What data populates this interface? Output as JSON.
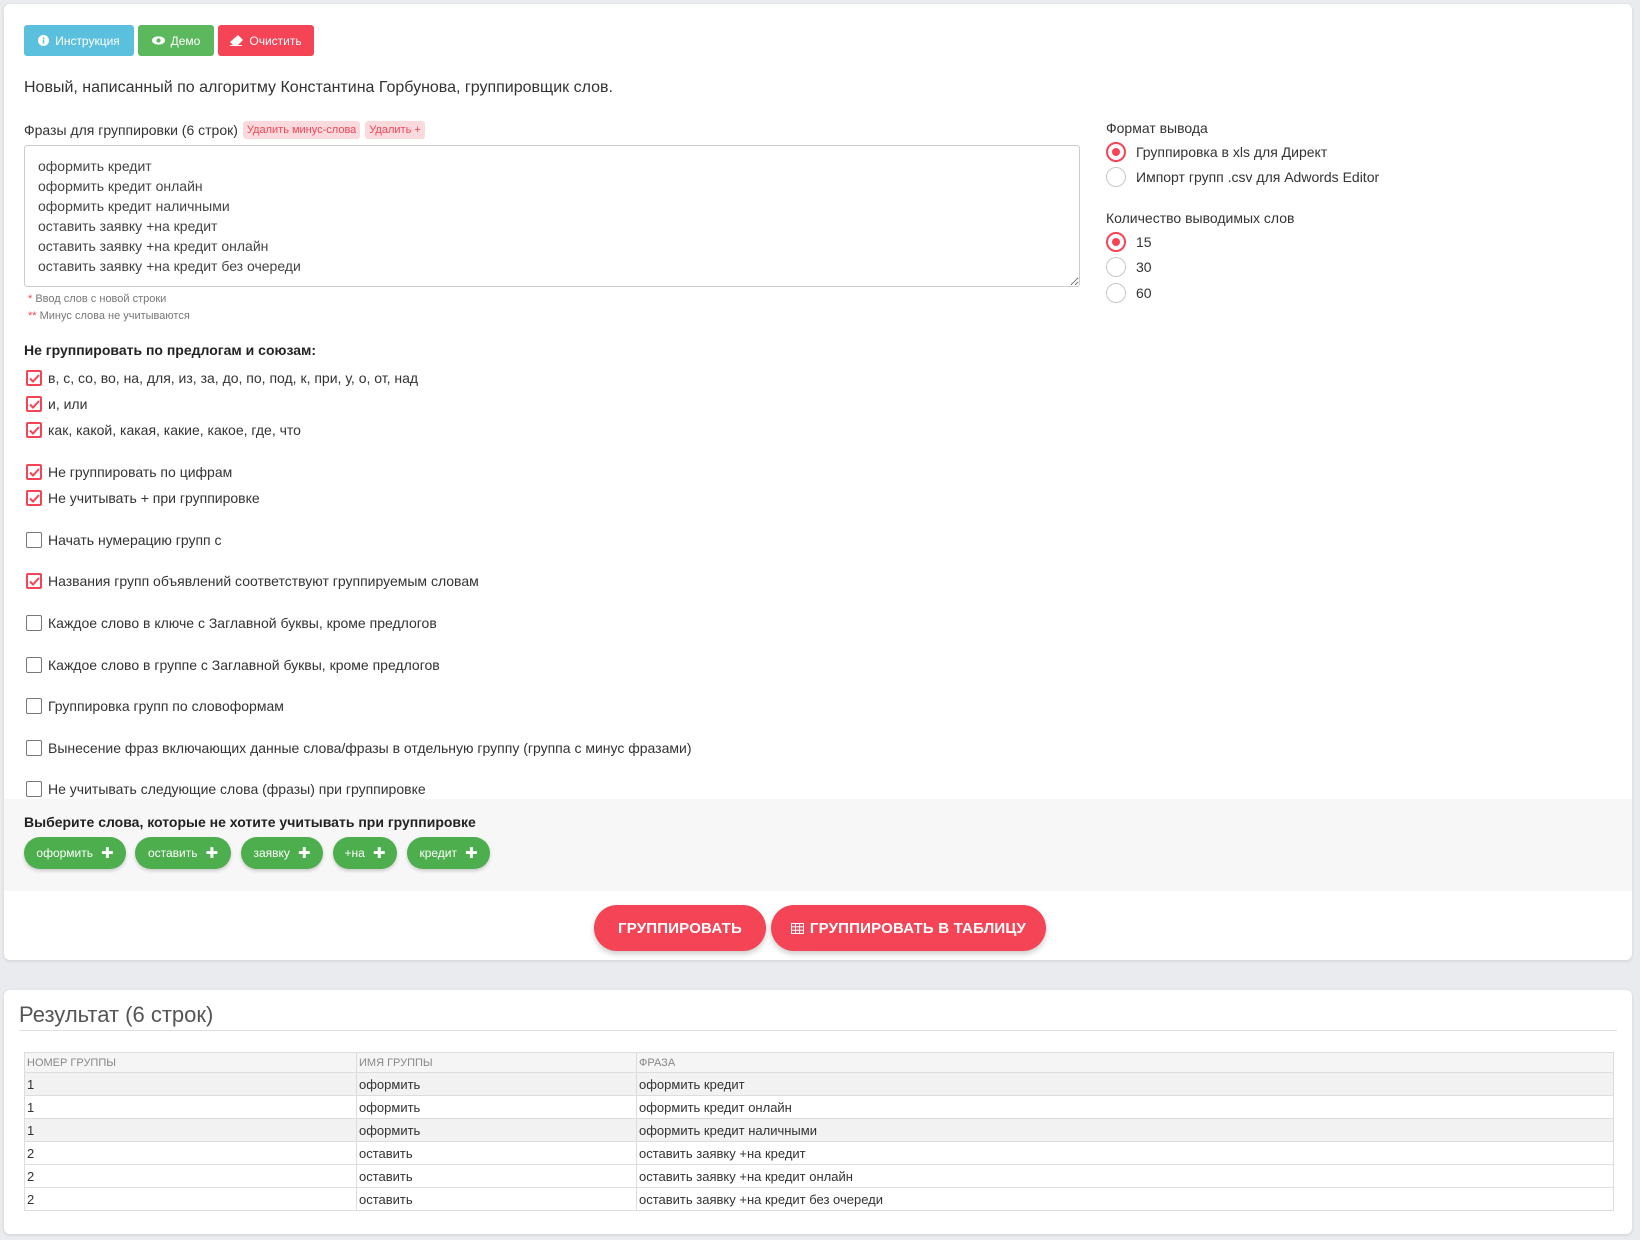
{
  "toolbar": {
    "instruction_label": "Инструкция",
    "demo_label": "Демо",
    "clear_label": "Очистить"
  },
  "description": "Новый, написанный по алгоритму Константина Горбунова, группировщик слов.",
  "phrases": {
    "label": "Фразы для группировки (6 строк)",
    "remove_minus_label": "Удалить минус-слова",
    "remove_plus_label": "Удалить +",
    "value": "оформить кредит\nоформить кредит онлайн\nоформить кредит наличными\nоставить заявку +на кредит\nоставить заявку +на кредит онлайн\nоставить заявку +на кредит без очереди",
    "note1_star": "*",
    "note1": "Ввод слов с новой строки",
    "note2_star": "**",
    "note2": "Минус слова не учитываются"
  },
  "prepositions": {
    "heading": "Не группировать по предлогам и союзам:",
    "items": [
      {
        "label": "в, с, со, во, на, для, из, за, до, по, под, к, при, у, о, от, над",
        "checked": true
      },
      {
        "label": "и, или",
        "checked": true
      },
      {
        "label": "как, какой, какая, какие, какое, где, что",
        "checked": true
      }
    ]
  },
  "options": [
    {
      "label": "Не группировать по цифрам",
      "checked": true
    },
    {
      "label": "Не учитывать + при группировке",
      "checked": true
    },
    {
      "label": "Начать нумерацию групп с",
      "checked": false
    },
    {
      "label": "Названия групп объявлений соответствуют группируемым словам",
      "checked": true
    },
    {
      "label": "Каждое слово в ключе с Заглавной буквы, кроме предлогов",
      "checked": false
    },
    {
      "label": "Каждое слово в группе с Заглавной буквы, кроме предлогов",
      "checked": false
    },
    {
      "label": "Группировка групп по словоформам",
      "checked": false
    },
    {
      "label": "Вынесение фраз включающих данные слова/фразы в отдельную группу (группа с минус фразами)",
      "checked": false
    },
    {
      "label": "Не учитывать следующие слова (фразы) при группировке",
      "checked": false
    }
  ],
  "output_format": {
    "label": "Формат вывода",
    "options": [
      {
        "label": "Группировка в xls для Директ",
        "selected": true
      },
      {
        "label": "Импорт групп .csv для Adwords Editor",
        "selected": false
      }
    ]
  },
  "word_count": {
    "label": "Количество выводимых слов",
    "options": [
      {
        "label": "15",
        "selected": true
      },
      {
        "label": "30",
        "selected": false
      },
      {
        "label": "60",
        "selected": false
      }
    ]
  },
  "exclude": {
    "heading": "Выберите слова, которые не хотите учитывать при группировке",
    "chips": [
      {
        "label": "оформить",
        "plus": "✚"
      },
      {
        "label": "оставить",
        "plus": "✚"
      },
      {
        "label": "заявку",
        "plus": "✚"
      },
      {
        "label": "+на",
        "plus": "✚"
      },
      {
        "label": "кредит",
        "plus": "✚"
      }
    ]
  },
  "actions": {
    "group_label": "ГРУППИРОВАТЬ",
    "group_table_label": "ГРУППИРОВАТЬ В ТАБЛИЦУ"
  },
  "result": {
    "title": "Результат (6 строк)",
    "columns": [
      "НОМЕР ГРУППЫ",
      "ИМЯ ГРУППЫ",
      "ФРАЗА"
    ],
    "rows": [
      [
        "1",
        "оформить",
        "оформить кредит"
      ],
      [
        "1",
        "оформить",
        "оформить кредит онлайн"
      ],
      [
        "1",
        "оформить",
        "оформить кредит наличными"
      ],
      [
        "2",
        "оставить",
        "оставить заявку +на кредит"
      ],
      [
        "2",
        "оставить",
        "оставить заявку +на кредит онлайн"
      ],
      [
        "2",
        "оставить",
        "оставить заявку +на кредит без очереди"
      ]
    ]
  },
  "colors": {
    "accent_red": "#f44455",
    "info_blue": "#5bc0de",
    "success_green": "#5cb85c",
    "chip_green": "#4cae4c"
  }
}
